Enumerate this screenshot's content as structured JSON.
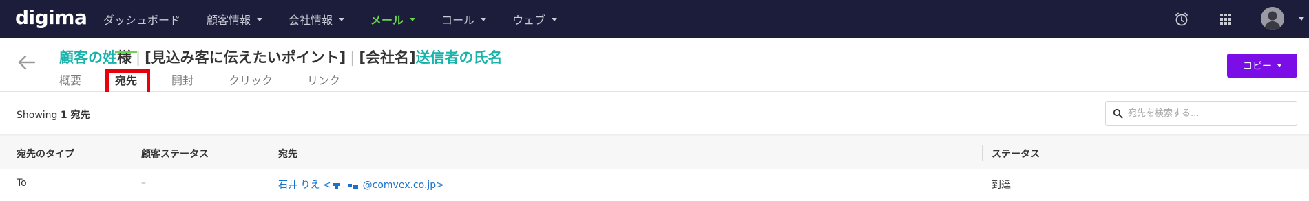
{
  "nav": {
    "logo": "digima",
    "items": [
      {
        "label": "ダッシュボード",
        "has_caret": false,
        "active": false
      },
      {
        "label": "顧客情報",
        "has_caret": true,
        "active": false
      },
      {
        "label": "会社情報",
        "has_caret": true,
        "active": false
      },
      {
        "label": "メール",
        "has_caret": true,
        "active": true
      },
      {
        "label": "コール",
        "has_caret": true,
        "active": false
      },
      {
        "label": "ウェブ",
        "has_caret": true,
        "active": false
      }
    ],
    "icons": [
      "alarm-clock-icon",
      "apps-grid-icon",
      "user-avatar-icon"
    ]
  },
  "header": {
    "title_parts": {
      "p1": "顧客の姓",
      "p2": "様",
      "p3": "[見込み客に伝えたいポイント]",
      "p4": "[会社名]",
      "p5": "送信者の氏名"
    },
    "tabs": [
      "概要",
      "宛先",
      "開封",
      "クリック",
      "リンク"
    ],
    "active_tab": "宛先",
    "copy_button": "コピー"
  },
  "toolbar": {
    "showing_prefix": "Showing",
    "showing_count": "1 宛先",
    "search_placeholder": "宛先を検索する..."
  },
  "table": {
    "columns": [
      "宛先のタイプ",
      "顧客ステータス",
      "宛先",
      "ステータス"
    ],
    "rows": [
      {
        "type": "To",
        "customer_status": "–",
        "recipient_name": "石井 りえ",
        "recipient_email_suffix": "@comvex.co.jp>",
        "status": "到達"
      }
    ]
  },
  "colors": {
    "nav_bg": "#1b1d3a",
    "accent_green": "#6ad34f",
    "teal": "#19b3ab",
    "purple_button": "#7b0de6",
    "link_blue": "#1a73c8",
    "highlight_red": "#e8000b"
  }
}
